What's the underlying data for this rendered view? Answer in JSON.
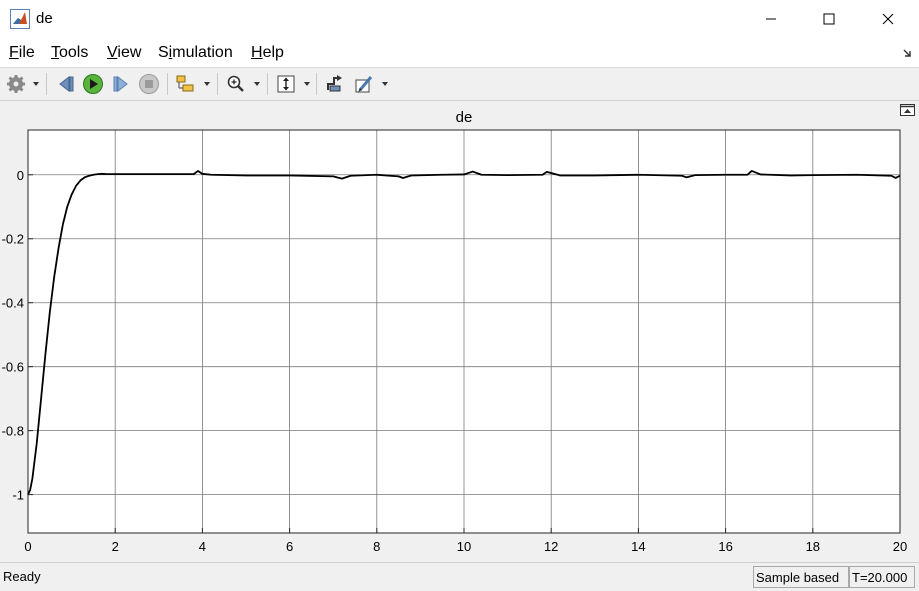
{
  "window": {
    "title": "de"
  },
  "menu": [
    {
      "pre": "",
      "ul": "F",
      "post": "ile"
    },
    {
      "pre": "",
      "ul": "T",
      "post": "ools"
    },
    {
      "pre": "",
      "ul": "V",
      "post": "iew"
    },
    {
      "pre": "S",
      "ul": "i",
      "post": "mulation"
    },
    {
      "pre": "",
      "ul": "H",
      "post": "elp"
    }
  ],
  "toolbar": {
    "icons": [
      "settings-icon",
      "step-back-icon",
      "run-icon",
      "step-forward-icon",
      "stop-icon",
      "signal-selector-icon",
      "zoom-in-icon",
      "autoscale-icon",
      "highlight-block-icon",
      "style-icon"
    ]
  },
  "colors": {
    "plot_bg": "#ffffff",
    "frame_bg": "#f0f0f0",
    "line": "#000000",
    "grid": "#7a7a7a"
  },
  "chart_data": {
    "type": "line",
    "title": "de",
    "xlabel": "",
    "ylabel": "",
    "xlim": [
      0,
      20
    ],
    "ylim": [
      -1.12,
      0.14
    ],
    "xticks": [
      0,
      2,
      4,
      6,
      8,
      10,
      12,
      14,
      16,
      18,
      20
    ],
    "yticks": [
      0,
      -0.2,
      -0.4,
      -0.6,
      -0.8,
      -1
    ],
    "ytick_labels": [
      "0",
      "-0.2",
      "-0.4",
      "-0.6",
      "-0.8",
      "-1"
    ],
    "grid": true,
    "series": [
      {
        "x": [
          0,
          0.05,
          0.1,
          0.2,
          0.3,
          0.4,
          0.5,
          0.6,
          0.7,
          0.8,
          0.9,
          1.0,
          1.1,
          1.2,
          1.3,
          1.4,
          1.5,
          1.6,
          1.7,
          1.8,
          2.0,
          3.0,
          3.8,
          3.9,
          4.0,
          4.2,
          5.0,
          6.0,
          7.0,
          7.2,
          7.4,
          8.0,
          8.5,
          8.6,
          8.8,
          9.5,
          10.0,
          10.2,
          10.4,
          11.0,
          11.8,
          11.9,
          12.2,
          13.0,
          14.0,
          15.0,
          15.1,
          15.3,
          16.0,
          16.5,
          16.6,
          16.8,
          17.5,
          18.0,
          19.0,
          19.8,
          19.9,
          20.0
        ],
        "y": [
          -1.0,
          -0.985,
          -0.95,
          -0.84,
          -0.7,
          -0.56,
          -0.43,
          -0.32,
          -0.23,
          -0.155,
          -0.1,
          -0.062,
          -0.035,
          -0.018,
          -0.008,
          -0.003,
          0.0,
          0.002,
          0.003,
          0.002,
          0.002,
          0.002,
          0.002,
          0.012,
          0.003,
          0.0,
          -0.002,
          -0.002,
          -0.005,
          -0.012,
          -0.003,
          0.0,
          -0.005,
          -0.01,
          -0.002,
          0.0,
          0.001,
          0.01,
          0.0,
          -0.001,
          0.0,
          0.009,
          -0.002,
          -0.002,
          0.0,
          -0.003,
          -0.008,
          -0.001,
          0.0,
          0.0,
          0.012,
          0.001,
          -0.002,
          -0.001,
          0.0,
          -0.003,
          -0.01,
          -0.003
        ]
      }
    ]
  },
  "status": {
    "ready": "Ready",
    "sample": "Sample based",
    "time": "T=20.000"
  }
}
